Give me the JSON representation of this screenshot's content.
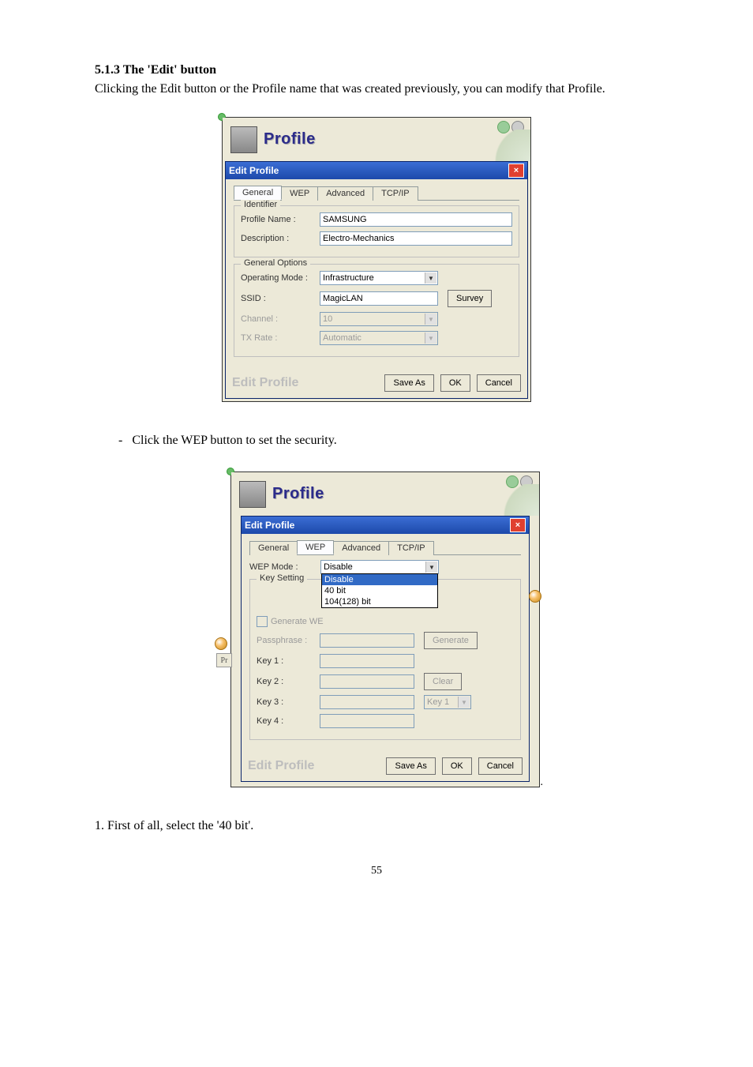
{
  "doc": {
    "heading": "5.1.3 The 'Edit' button",
    "intro": "Clicking the Edit button or the Profile name that was created previously, you can modify that Profile.",
    "bullet": "Click the WEP button to set the security.",
    "step1": "1. First of all, select the '40 bit'.",
    "page": "55"
  },
  "shot1": {
    "header_title": "Profile",
    "titlebar": "Edit Profile",
    "tabs": [
      "General",
      "WEP",
      "Advanced",
      "TCP/IP"
    ],
    "active_tab": 0,
    "group_identifier": "Identifier",
    "label_profile_name": "Profile Name :",
    "value_profile_name": "SAMSUNG",
    "label_description": "Description :",
    "value_description": "Electro-Mechanics",
    "group_general": "General Options",
    "label_operating_mode": "Operating Mode :",
    "value_operating_mode": "Infrastructure",
    "label_ssid": "SSID :",
    "value_ssid": "MagicLAN",
    "btn_survey": "Survey",
    "label_channel": "Channel :",
    "value_channel": "10",
    "label_txrate": "TX Rate :",
    "value_txrate": "Automatic",
    "footer_label": "Edit Profile",
    "btn_saveas": "Save As",
    "btn_ok": "OK",
    "btn_cancel": "Cancel"
  },
  "shot2": {
    "header_title": "Profile",
    "titlebar": "Edit Profile",
    "tabs": [
      "General",
      "WEP",
      "Advanced",
      "TCP/IP"
    ],
    "active_tab": 1,
    "label_wep_mode": "WEP Mode :",
    "value_wep_mode": "Disable",
    "wep_options": [
      "Disable",
      "40 bit",
      "104(128) bit"
    ],
    "wep_selected_index": 0,
    "group_key_setting": "Key Setting",
    "checkbox_generate": "Generate WE",
    "label_passphrase": "Passphrase :",
    "label_key1": "Key 1 :",
    "label_key2": "Key 2 :",
    "label_key3": "Key 3 :",
    "label_key4": "Key 4 :",
    "btn_generate": "Generate",
    "btn_clear": "Clear",
    "default_key": "Key 1",
    "footer_label": "Edit Profile",
    "btn_saveas": "Save As",
    "btn_ok": "OK",
    "btn_cancel": "Cancel",
    "side_label": "Pr"
  }
}
